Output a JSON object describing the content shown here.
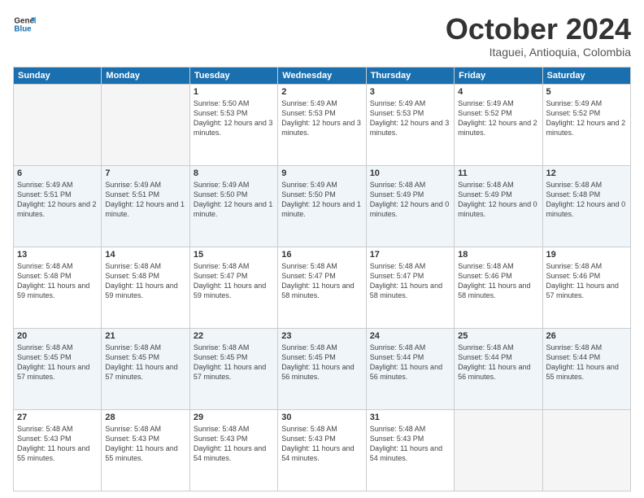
{
  "header": {
    "logo_general": "General",
    "logo_blue": "Blue",
    "month_title": "October 2024",
    "location": "Itaguei, Antioquia, Colombia"
  },
  "weekdays": [
    "Sunday",
    "Monday",
    "Tuesday",
    "Wednesday",
    "Thursday",
    "Friday",
    "Saturday"
  ],
  "weeks": [
    [
      {
        "day": "",
        "sunrise": "",
        "sunset": "",
        "daylight": "",
        "empty": true
      },
      {
        "day": "",
        "sunrise": "",
        "sunset": "",
        "daylight": "",
        "empty": true
      },
      {
        "day": "1",
        "sunrise": "Sunrise: 5:50 AM",
        "sunset": "Sunset: 5:53 PM",
        "daylight": "Daylight: 12 hours and 3 minutes.",
        "empty": false
      },
      {
        "day": "2",
        "sunrise": "Sunrise: 5:49 AM",
        "sunset": "Sunset: 5:53 PM",
        "daylight": "Daylight: 12 hours and 3 minutes.",
        "empty": false
      },
      {
        "day": "3",
        "sunrise": "Sunrise: 5:49 AM",
        "sunset": "Sunset: 5:53 PM",
        "daylight": "Daylight: 12 hours and 3 minutes.",
        "empty": false
      },
      {
        "day": "4",
        "sunrise": "Sunrise: 5:49 AM",
        "sunset": "Sunset: 5:52 PM",
        "daylight": "Daylight: 12 hours and 2 minutes.",
        "empty": false
      },
      {
        "day": "5",
        "sunrise": "Sunrise: 5:49 AM",
        "sunset": "Sunset: 5:52 PM",
        "daylight": "Daylight: 12 hours and 2 minutes.",
        "empty": false
      }
    ],
    [
      {
        "day": "6",
        "sunrise": "Sunrise: 5:49 AM",
        "sunset": "Sunset: 5:51 PM",
        "daylight": "Daylight: 12 hours and 2 minutes.",
        "empty": false
      },
      {
        "day": "7",
        "sunrise": "Sunrise: 5:49 AM",
        "sunset": "Sunset: 5:51 PM",
        "daylight": "Daylight: 12 hours and 1 minute.",
        "empty": false
      },
      {
        "day": "8",
        "sunrise": "Sunrise: 5:49 AM",
        "sunset": "Sunset: 5:50 PM",
        "daylight": "Daylight: 12 hours and 1 minute.",
        "empty": false
      },
      {
        "day": "9",
        "sunrise": "Sunrise: 5:49 AM",
        "sunset": "Sunset: 5:50 PM",
        "daylight": "Daylight: 12 hours and 1 minute.",
        "empty": false
      },
      {
        "day": "10",
        "sunrise": "Sunrise: 5:48 AM",
        "sunset": "Sunset: 5:49 PM",
        "daylight": "Daylight: 12 hours and 0 minutes.",
        "empty": false
      },
      {
        "day": "11",
        "sunrise": "Sunrise: 5:48 AM",
        "sunset": "Sunset: 5:49 PM",
        "daylight": "Daylight: 12 hours and 0 minutes.",
        "empty": false
      },
      {
        "day": "12",
        "sunrise": "Sunrise: 5:48 AM",
        "sunset": "Sunset: 5:48 PM",
        "daylight": "Daylight: 12 hours and 0 minutes.",
        "empty": false
      }
    ],
    [
      {
        "day": "13",
        "sunrise": "Sunrise: 5:48 AM",
        "sunset": "Sunset: 5:48 PM",
        "daylight": "Daylight: 11 hours and 59 minutes.",
        "empty": false
      },
      {
        "day": "14",
        "sunrise": "Sunrise: 5:48 AM",
        "sunset": "Sunset: 5:48 PM",
        "daylight": "Daylight: 11 hours and 59 minutes.",
        "empty": false
      },
      {
        "day": "15",
        "sunrise": "Sunrise: 5:48 AM",
        "sunset": "Sunset: 5:47 PM",
        "daylight": "Daylight: 11 hours and 59 minutes.",
        "empty": false
      },
      {
        "day": "16",
        "sunrise": "Sunrise: 5:48 AM",
        "sunset": "Sunset: 5:47 PM",
        "daylight": "Daylight: 11 hours and 58 minutes.",
        "empty": false
      },
      {
        "day": "17",
        "sunrise": "Sunrise: 5:48 AM",
        "sunset": "Sunset: 5:47 PM",
        "daylight": "Daylight: 11 hours and 58 minutes.",
        "empty": false
      },
      {
        "day": "18",
        "sunrise": "Sunrise: 5:48 AM",
        "sunset": "Sunset: 5:46 PM",
        "daylight": "Daylight: 11 hours and 58 minutes.",
        "empty": false
      },
      {
        "day": "19",
        "sunrise": "Sunrise: 5:48 AM",
        "sunset": "Sunset: 5:46 PM",
        "daylight": "Daylight: 11 hours and 57 minutes.",
        "empty": false
      }
    ],
    [
      {
        "day": "20",
        "sunrise": "Sunrise: 5:48 AM",
        "sunset": "Sunset: 5:45 PM",
        "daylight": "Daylight: 11 hours and 57 minutes.",
        "empty": false
      },
      {
        "day": "21",
        "sunrise": "Sunrise: 5:48 AM",
        "sunset": "Sunset: 5:45 PM",
        "daylight": "Daylight: 11 hours and 57 minutes.",
        "empty": false
      },
      {
        "day": "22",
        "sunrise": "Sunrise: 5:48 AM",
        "sunset": "Sunset: 5:45 PM",
        "daylight": "Daylight: 11 hours and 57 minutes.",
        "empty": false
      },
      {
        "day": "23",
        "sunrise": "Sunrise: 5:48 AM",
        "sunset": "Sunset: 5:45 PM",
        "daylight": "Daylight: 11 hours and 56 minutes.",
        "empty": false
      },
      {
        "day": "24",
        "sunrise": "Sunrise: 5:48 AM",
        "sunset": "Sunset: 5:44 PM",
        "daylight": "Daylight: 11 hours and 56 minutes.",
        "empty": false
      },
      {
        "day": "25",
        "sunrise": "Sunrise: 5:48 AM",
        "sunset": "Sunset: 5:44 PM",
        "daylight": "Daylight: 11 hours and 56 minutes.",
        "empty": false
      },
      {
        "day": "26",
        "sunrise": "Sunrise: 5:48 AM",
        "sunset": "Sunset: 5:44 PM",
        "daylight": "Daylight: 11 hours and 55 minutes.",
        "empty": false
      }
    ],
    [
      {
        "day": "27",
        "sunrise": "Sunrise: 5:48 AM",
        "sunset": "Sunset: 5:43 PM",
        "daylight": "Daylight: 11 hours and 55 minutes.",
        "empty": false
      },
      {
        "day": "28",
        "sunrise": "Sunrise: 5:48 AM",
        "sunset": "Sunset: 5:43 PM",
        "daylight": "Daylight: 11 hours and 55 minutes.",
        "empty": false
      },
      {
        "day": "29",
        "sunrise": "Sunrise: 5:48 AM",
        "sunset": "Sunset: 5:43 PM",
        "daylight": "Daylight: 11 hours and 54 minutes.",
        "empty": false
      },
      {
        "day": "30",
        "sunrise": "Sunrise: 5:48 AM",
        "sunset": "Sunset: 5:43 PM",
        "daylight": "Daylight: 11 hours and 54 minutes.",
        "empty": false
      },
      {
        "day": "31",
        "sunrise": "Sunrise: 5:48 AM",
        "sunset": "Sunset: 5:43 PM",
        "daylight": "Daylight: 11 hours and 54 minutes.",
        "empty": false
      },
      {
        "day": "",
        "sunrise": "",
        "sunset": "",
        "daylight": "",
        "empty": true
      },
      {
        "day": "",
        "sunrise": "",
        "sunset": "",
        "daylight": "",
        "empty": true
      }
    ]
  ]
}
